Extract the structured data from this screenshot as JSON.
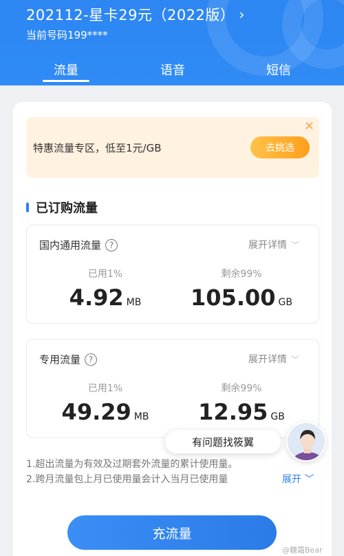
{
  "header": {
    "plan_title": "202112-星卡29元（2022版）",
    "phone_label": "当前号码199****",
    "tabs": [
      "流量",
      "语音",
      "短信"
    ]
  },
  "promo": {
    "text": "特惠流量专区，低至1元/GB",
    "button": "去挑选",
    "close": "×"
  },
  "section": {
    "title": "已订购流量"
  },
  "usage": [
    {
      "label": "国内通用流量",
      "expand": "展开详情",
      "used_label": "已用1%",
      "used_value": "4.92",
      "used_unit": "MB",
      "remain_label": "剩余99%",
      "remain_value": "105.00",
      "remain_unit": "GB"
    },
    {
      "label": "专用流量",
      "expand": "展开详情",
      "used_label": "已用1%",
      "used_value": "49.29",
      "used_unit": "MB",
      "remain_label": "剩余99%",
      "remain_value": "12.95",
      "remain_unit": "GB"
    }
  ],
  "notes": {
    "line1": "1.超出流量为有效及过期套外流量的累计使用量。",
    "line2": "2.跨月流量包上月已使用量会计入当月已使用量",
    "expand": "展开"
  },
  "assistant": {
    "bubble": "有问题找筱翼"
  },
  "cta": {
    "label": "充流量"
  },
  "watermark": "@糖霜Bear",
  "colors": {
    "primary": "#2f86f3",
    "accent": "#ff9f1c"
  }
}
